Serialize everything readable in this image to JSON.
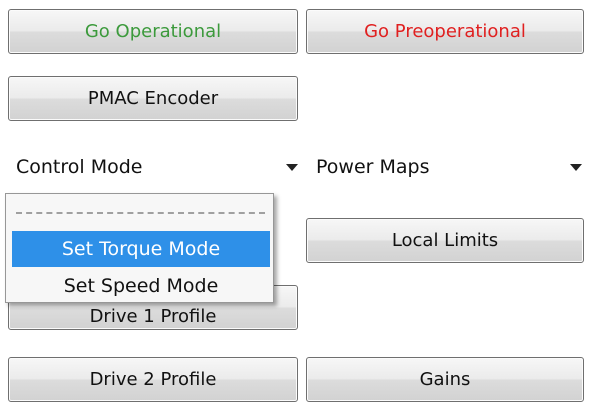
{
  "buttons": {
    "go_operational": "Go Operational",
    "go_preoperational": "Go Preoperational",
    "pmac_encoder": "PMAC Encoder",
    "local_limits": "Local Limits",
    "drive1_profile": "Drive 1 Profile",
    "drive2_profile": "Drive 2 Profile",
    "gains": "Gains"
  },
  "dropdowns": {
    "control_mode": "Control Mode",
    "power_maps": "Power Maps"
  },
  "control_mode_menu": {
    "items": [
      {
        "label": "Set Torque Mode",
        "selected": true
      },
      {
        "label": "Set Speed Mode",
        "selected": false
      }
    ]
  },
  "colors": {
    "go_operational_text": "#3c9a3c",
    "go_preoperational_text": "#e02020",
    "selection_background": "#2e90e8"
  }
}
